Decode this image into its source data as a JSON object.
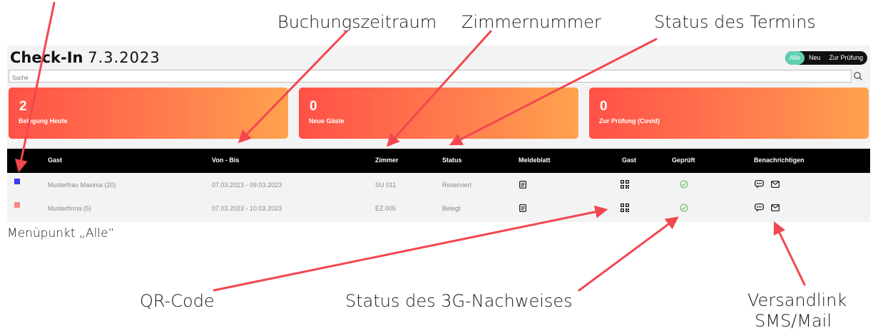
{
  "annotations": {
    "booking_period": "Buchungszeitraum",
    "room_number": "Zimmernummer",
    "appointment_status": "Status des Termins",
    "menu_all": "Menüpunkt „Alle“",
    "qr_code": "QR-Code",
    "status_3g": "Status des 3G-Nachweises",
    "send_link_1": "Versandlink",
    "send_link_2": "SMS/Mail"
  },
  "page": {
    "title_bold": "Check-In",
    "title_date": "7.3.2023"
  },
  "filter": {
    "all": "Alle",
    "new": "Neu",
    "review": "Zur Prüfung",
    "active": "Alle"
  },
  "search": {
    "placeholder": "Suche"
  },
  "cards": [
    {
      "value": "2",
      "label": "Belegung Heute"
    },
    {
      "value": "0",
      "label": "Neue Gäste"
    },
    {
      "value": "0",
      "label": "Zur Prüfung (Covid)"
    }
  ],
  "table": {
    "headers": {
      "guest": "Gast",
      "period": "Von - Bis",
      "room": "Zimmer",
      "status": "Status",
      "registration": "Meldeblatt",
      "guest_qr": "Gast",
      "checked": "Geprüft",
      "notify": "Benachrichtigen"
    },
    "rows": [
      {
        "marker_color": "#3b3bf0",
        "guest": "Musterfrau Maxima (20)",
        "period": "07.03.2023 - 09.03.2023",
        "room": "SU 011",
        "status": "Reserviert"
      },
      {
        "marker_color": "#f28a8a",
        "guest": "Musterfirma (5)",
        "period": "07.03.2023 - 10.03.2023",
        "room": "EZ 005",
        "status": "Belegt"
      }
    ]
  },
  "colors": {
    "accent_teal": "#5fd1b3",
    "card_gradient_start": "#ff5147",
    "card_gradient_end": "#ffa24e",
    "arrow": "#f2474f",
    "check_green": "#5fbf5f"
  }
}
